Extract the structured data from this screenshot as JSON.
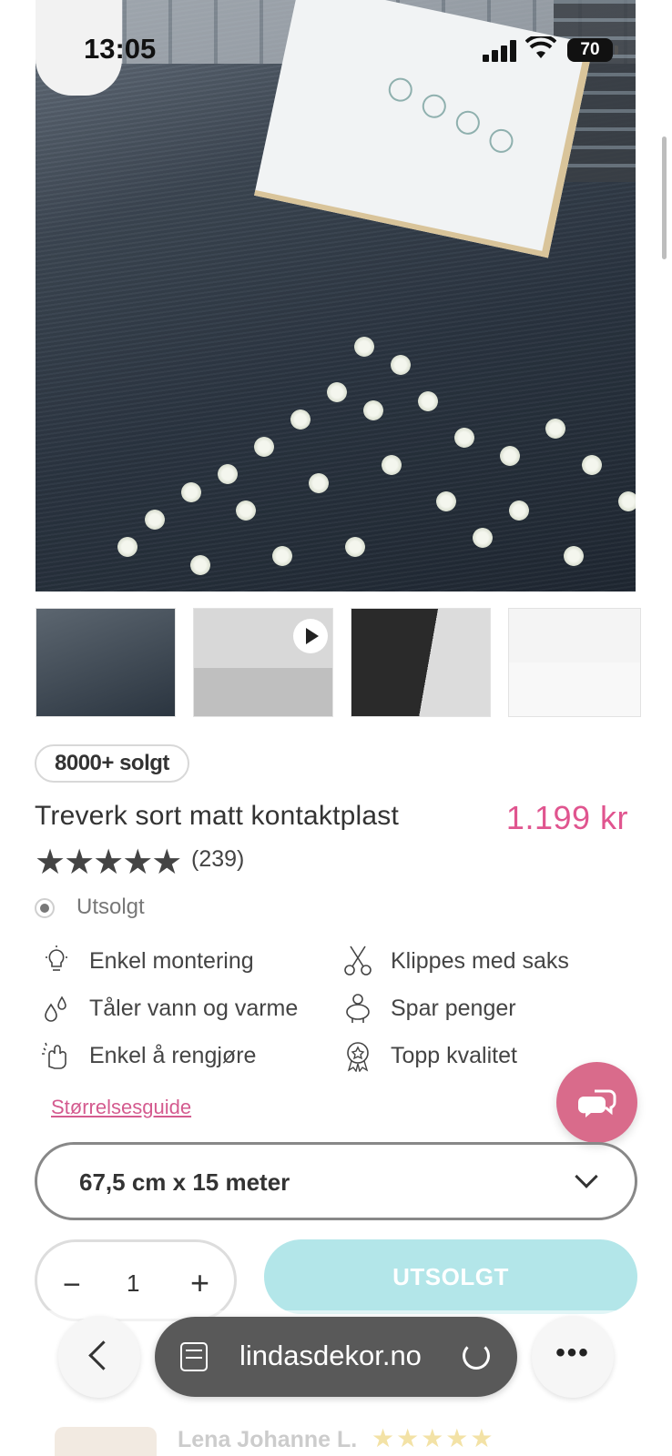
{
  "status_bar": {
    "time": "13:05",
    "battery": "70"
  },
  "product": {
    "sold_badge": "8000+ solgt",
    "title": "Treverk sort matt kontaktplast",
    "price": "1.199 kr",
    "rating_stars": "★★★★★",
    "review_count": "(239)",
    "stock_status": "Utsolgt"
  },
  "features": [
    {
      "label": "Enkel montering",
      "icon": "lightbulb-icon"
    },
    {
      "label": "Klippes med saks",
      "icon": "scissors-icon"
    },
    {
      "label": "Tåler vann og varme",
      "icon": "water-drops-icon"
    },
    {
      "label": "Spar penger",
      "icon": "piggy-bank-icon"
    },
    {
      "label": "Enkel å rengjøre",
      "icon": "cleaning-hand-icon"
    },
    {
      "label": "Topp kvalitet",
      "icon": "quality-badge-icon"
    }
  ],
  "size_guide_label": "Størrelsesguide",
  "size_select": {
    "value": "67,5 cm x 15 meter"
  },
  "quantity": {
    "value": "1",
    "minus": "−",
    "plus": "+"
  },
  "buy_button_label": "UTSOLGT",
  "browser": {
    "url": "lindasdekor.no",
    "more": "•••"
  },
  "review_preview": {
    "name": "Lena Johanne L.",
    "stars": "★★★★★"
  },
  "colors": {
    "accent_pink": "#e0558f",
    "button_teal": "#b3e6e9",
    "chat_pink": "#d96b8b"
  }
}
